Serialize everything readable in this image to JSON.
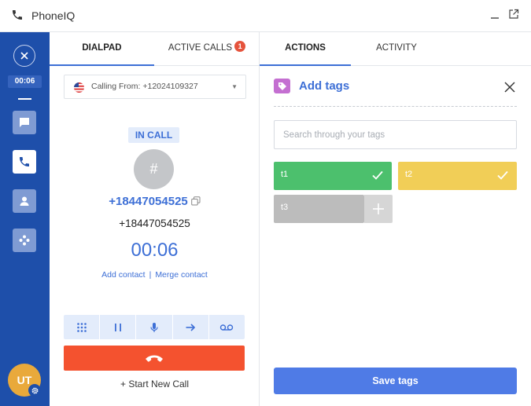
{
  "window": {
    "title": "PhoneIQ",
    "icons": {
      "app": "phone-icon",
      "minimize": "minimize-icon",
      "popout": "external-link-icon"
    }
  },
  "sidebar": {
    "timer": "00:06",
    "items": [
      {
        "icon": "chat-icon",
        "active": false
      },
      {
        "icon": "phone-icon",
        "active": true
      },
      {
        "icon": "contact-icon",
        "active": false
      },
      {
        "icon": "integrations-icon",
        "active": false
      }
    ],
    "avatar_initials": "UT"
  },
  "left_panel": {
    "tabs": [
      {
        "label": "DIALPAD",
        "active": true
      },
      {
        "label": "ACTIVE CALLS",
        "badge": "1",
        "active": false
      }
    ],
    "calling_from": "Calling From: +12024109327",
    "status": "IN CALL",
    "contact_initial": "#",
    "number_link": "+18447054525",
    "number_plain": "+18447054525",
    "timer": "00:06",
    "add_contact": "Add contact",
    "separator": "|",
    "merge_contact": "Merge contact",
    "controls": [
      "keypad-icon",
      "hold-icon",
      "mic-icon",
      "transfer-icon",
      "voicemail-icon"
    ],
    "new_call": "+ Start New Call"
  },
  "right_panel": {
    "tabs": [
      {
        "label": "ACTIONS",
        "active": true
      },
      {
        "label": "ACTIVITY",
        "active": false
      }
    ],
    "title": "Add tags",
    "search_placeholder": "Search through your tags",
    "tags": [
      {
        "label": "t1",
        "color": "#4cc06d",
        "selected": true
      },
      {
        "label": "t2",
        "color": "#f1ce57",
        "selected": true
      },
      {
        "label": "t3",
        "color": "#bcbcbc",
        "selected": false
      }
    ],
    "save_label": "Save tags"
  },
  "colors": {
    "sidebar": "#1e4faa",
    "accent": "#3d6fd6",
    "hangup": "#f4522f",
    "save": "#4f7be6",
    "badge": "#e5533c"
  }
}
